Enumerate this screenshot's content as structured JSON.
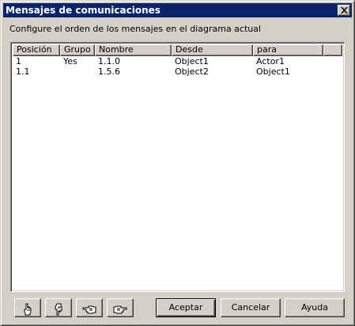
{
  "window": {
    "title": "Mensajes de comunicaciones"
  },
  "instructions": "Configure el orden de los mensajes en el diagrama actual",
  "list": {
    "columns": [
      "Posición",
      "Grupo",
      "Nombre",
      "Desde",
      "para"
    ],
    "rows": [
      [
        "1",
        "Yes",
        "1.1.0",
        "Object1",
        "Actor1"
      ],
      [
        "1.1",
        "",
        "1.5.6",
        "Object2",
        "Object1"
      ]
    ]
  },
  "toolbar": {
    "icons": [
      "hand-point-up-icon",
      "hand-point-down-icon",
      "hand-point-left-icon",
      "hand-point-right-icon"
    ]
  },
  "buttons": {
    "accept": "Aceptar",
    "cancel": "Cancelar",
    "help": "Ayuda"
  }
}
